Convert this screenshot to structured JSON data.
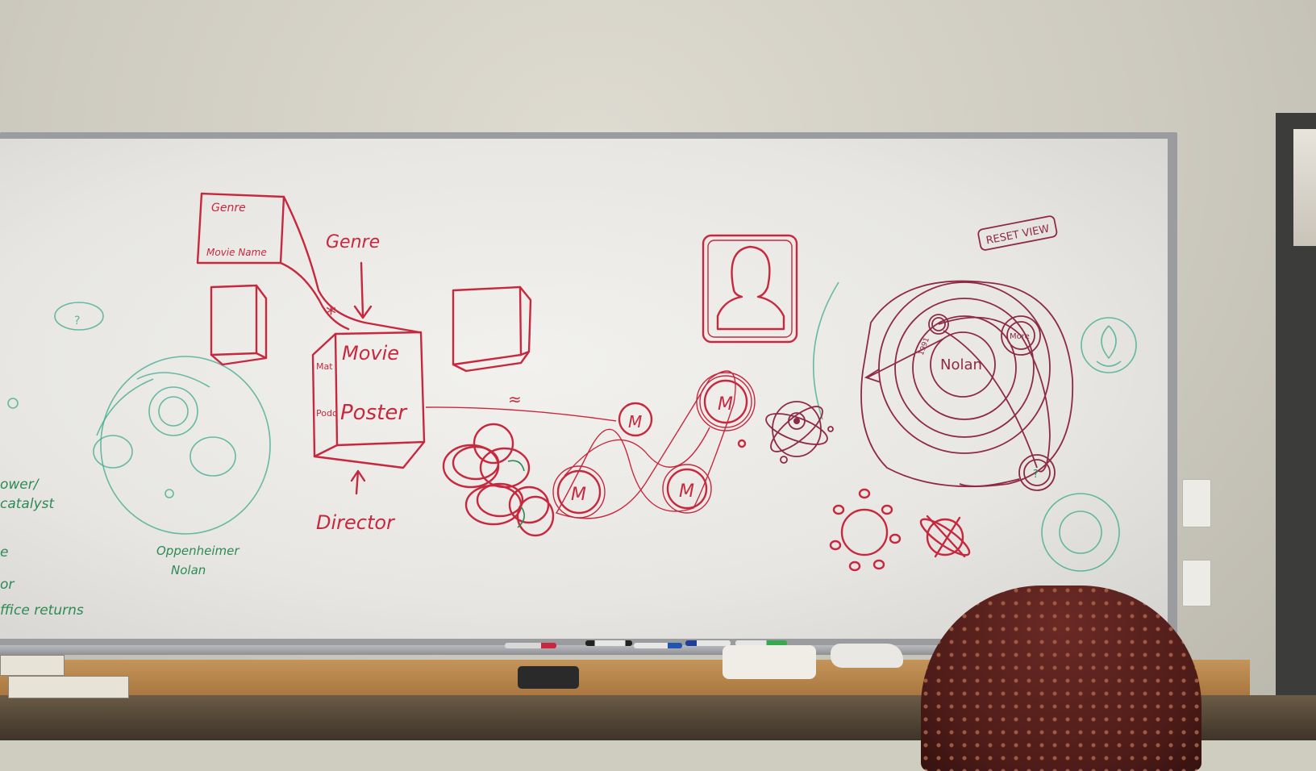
{
  "image": {
    "description_free": true
  },
  "board_text": {
    "box_genre": "Genre",
    "box_movie_name": "Movie Name",
    "genre_label": "Genre",
    "movie_label": "Movie",
    "poster_label": "Poster",
    "side_label_top": "Mat",
    "side_label_bottom": "Podo",
    "director_label": "Director",
    "asterisk": "*",
    "reset_view": "RESET VIEW",
    "nolan": "Nolan",
    "node_m": "M",
    "node_more": "More",
    "node_q": "?",
    "approx": "≈",
    "year": "1991",
    "left_q": "?",
    "green_caption_1": "Oppenheimer",
    "green_caption_2": "Nolan",
    "left_notes": [
      "ower/",
      "catalyst",
      "e",
      "or",
      "ffice returns"
    ]
  },
  "colors": {
    "red_marker": "#c8283e",
    "dark_marker": "#8e2a46",
    "teal_marker": "#3aa88e",
    "green_marker": "#2e8a55"
  }
}
